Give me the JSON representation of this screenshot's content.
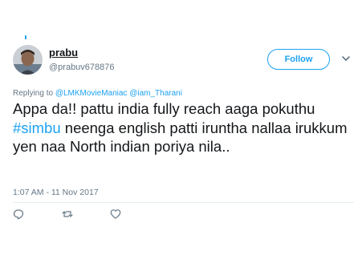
{
  "author": {
    "display_name": "prabu",
    "handle": "@prabuv678876"
  },
  "follow_button": {
    "label": "Follow"
  },
  "reply": {
    "prefix": "Replying to ",
    "mentions": [
      "@LMKMovieManiac",
      "@iam_Tharani"
    ]
  },
  "tweet": {
    "text_before": "Appa da!! pattu india fully reach aaga pokuthu ",
    "hashtag": "#simbu",
    "text_after": " neenga english patti iruntha nallaa irukkum yen naa North indian poriya nila.."
  },
  "timestamp": "1:07 AM - 11 Nov 2017",
  "icons": {
    "chevron": "chevron-down-icon",
    "reply": "reply-icon",
    "retweet": "retweet-icon",
    "like": "heart-icon"
  },
  "colors": {
    "accent": "#1da1f2",
    "secondary_text": "#657786",
    "primary_text": "#14171a"
  }
}
